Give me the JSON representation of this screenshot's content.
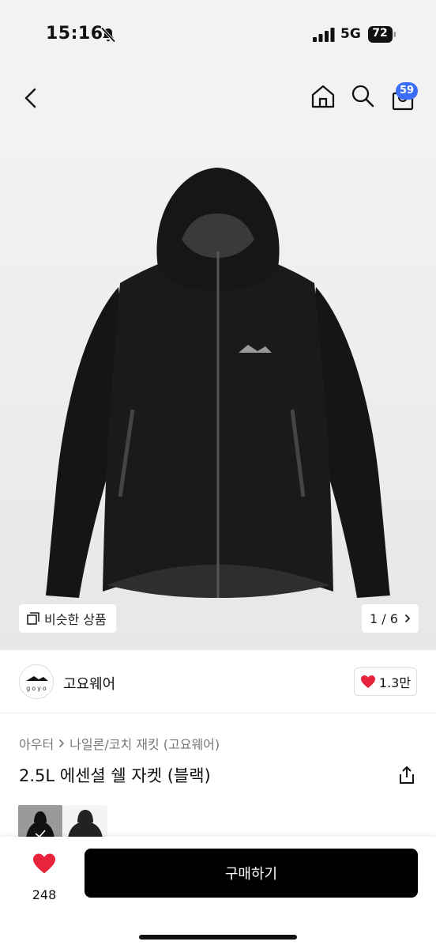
{
  "status_bar": {
    "time": "15:16",
    "network": "5G",
    "battery": "72"
  },
  "nav": {
    "cart_count": "59",
    "icons": [
      "back-arrow-icon",
      "home-icon",
      "search-icon",
      "cart-icon"
    ]
  },
  "hero": {
    "similar_label": "비슷한 상품",
    "pager": "1 / 6"
  },
  "shop": {
    "logo_text": "goyo",
    "name": "고요웨어",
    "likes": "1.3만"
  },
  "product": {
    "breadcrumb": [
      "아우터",
      "나일론/코치 재킷 (고요웨어)"
    ],
    "title": "2.5L 에센셜 쉘 자켓 (블랙)"
  },
  "bottom": {
    "wish_count": "248",
    "buy_label": "구매하기"
  },
  "colors": {
    "accent": "#3b6ef5",
    "heart": "#e8243c",
    "button": "#000000"
  }
}
